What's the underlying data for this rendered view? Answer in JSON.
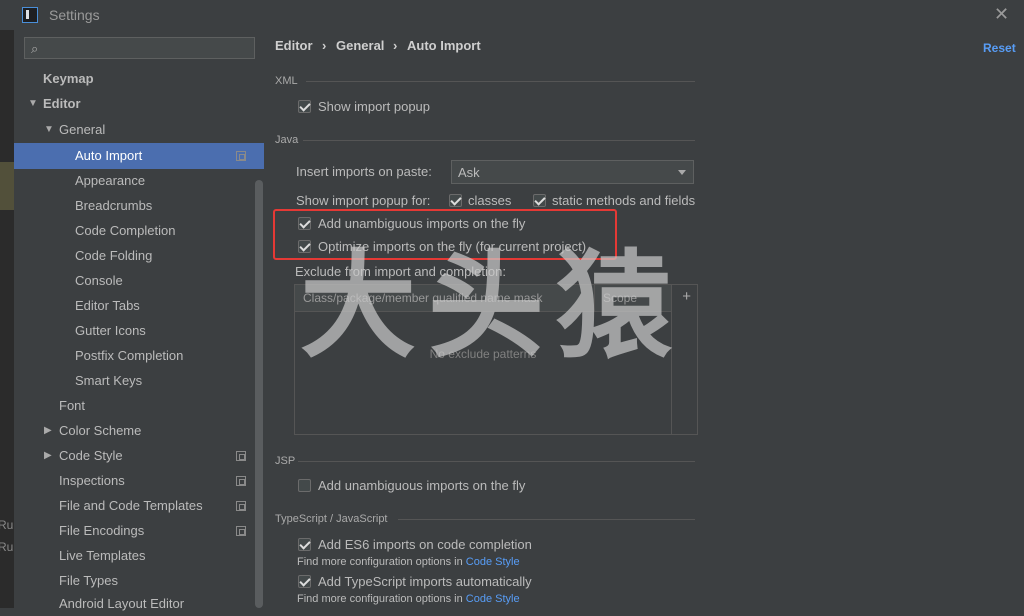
{
  "window": {
    "title": "Settings"
  },
  "left_edge": {
    "texts": [
      "Rul",
      "Rul"
    ]
  },
  "sidebar": {
    "search_placeholder": "",
    "items": [
      {
        "label": "Keymap"
      },
      {
        "label": "Editor"
      },
      {
        "label": "General"
      },
      {
        "label": "Auto Import"
      },
      {
        "label": "Appearance"
      },
      {
        "label": "Breadcrumbs"
      },
      {
        "label": "Code Completion"
      },
      {
        "label": "Code Folding"
      },
      {
        "label": "Console"
      },
      {
        "label": "Editor Tabs"
      },
      {
        "label": "Gutter Icons"
      },
      {
        "label": "Postfix Completion"
      },
      {
        "label": "Smart Keys"
      },
      {
        "label": "Font"
      },
      {
        "label": "Color Scheme"
      },
      {
        "label": "Code Style"
      },
      {
        "label": "Inspections"
      },
      {
        "label": "File and Code Templates"
      },
      {
        "label": "File Encodings"
      },
      {
        "label": "Live Templates"
      },
      {
        "label": "File Types"
      },
      {
        "label": "Android Layout Editor"
      }
    ]
  },
  "breadcrumb": {
    "items": [
      "Editor",
      "General",
      "Auto Import"
    ],
    "separator": "›"
  },
  "reset_label": "Reset",
  "xml": {
    "section_label": "XML",
    "show_import_popup": {
      "label": "Show import popup",
      "checked": true
    }
  },
  "java": {
    "section_label": "Java",
    "insert_on_paste_label": "Insert imports on paste:",
    "insert_on_paste_value": "Ask",
    "show_popup_for_label": "Show import popup for:",
    "classes": {
      "label": "classes",
      "checked": true
    },
    "static_methods": {
      "label": "static methods and fields",
      "checked": true
    },
    "add_unambiguous": {
      "label": "Add unambiguous imports on the fly",
      "checked": true
    },
    "optimize_imports": {
      "label": "Optimize imports on the fly (for current project)",
      "checked": true
    },
    "exclude_label": "Exclude from import and completion:",
    "table": {
      "columns": [
        "Class/package/member qualified name mask",
        "Scope"
      ],
      "add_symbol": "+",
      "empty_text": "No exclude patterns"
    }
  },
  "jsp": {
    "section_label": "JSP",
    "add_unambiguous": {
      "label": "Add unambiguous imports on the fly",
      "checked": false
    }
  },
  "typescript": {
    "section_label": "TypeScript / JavaScript",
    "es6": {
      "label": "Add ES6 imports on code completion",
      "checked": true
    },
    "es6_more_prefix": "Find more configuration options in",
    "es6_more_link": "Code Style",
    "ts_auto": {
      "label": "Add TypeScript imports automatically",
      "checked": true
    },
    "ts_more_prefix": "Find more configuration options in",
    "ts_more_link": "Code Style"
  },
  "watermark": {
    "text": "大头猿"
  },
  "colors": {
    "accent": "#4b6eaf",
    "link": "#589df6",
    "highlight_box": "#e53935",
    "background": "#3c3f41"
  }
}
